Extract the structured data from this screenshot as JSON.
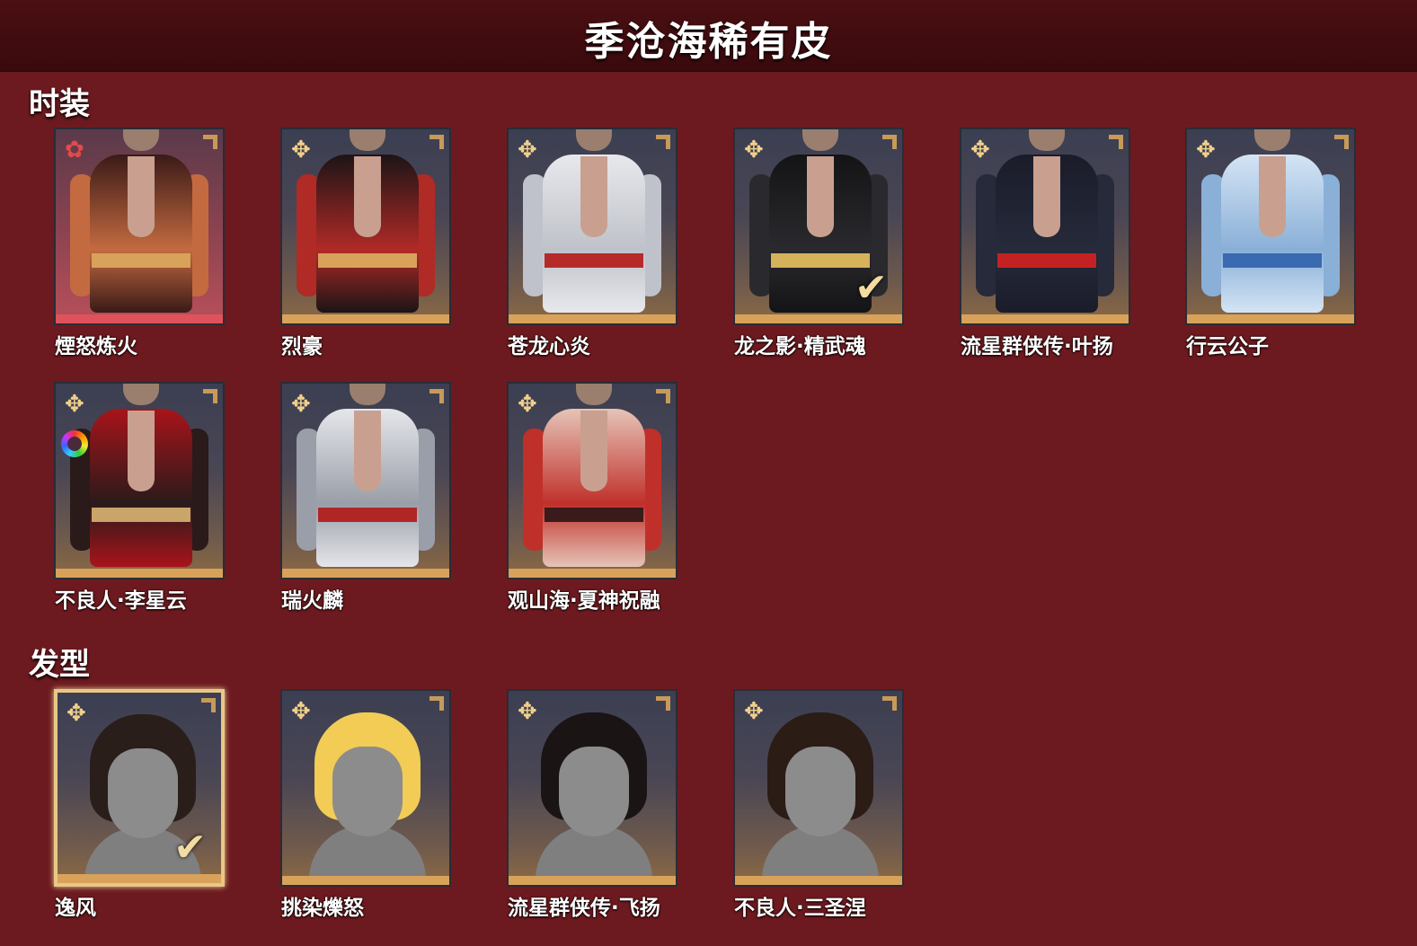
{
  "title": "季沧海稀有皮",
  "sections": {
    "outfits": {
      "title": "时装",
      "items": [
        {
          "name": "煙怒炼火",
          "rarity": "red",
          "rarity_icon": "red-star-icon",
          "colors": [
            "#3a1a18",
            "#c46a40",
            "#d9a25a"
          ]
        },
        {
          "name": "烈豪",
          "rarity": "gold",
          "rarity_icon": "gold-star-icon",
          "colors": [
            "#1c1416",
            "#b02a26",
            "#d9a25a"
          ]
        },
        {
          "name": "苍龙心炎",
          "rarity": "gold",
          "rarity_icon": "gold-star-icon",
          "colors": [
            "#e8e8ec",
            "#bfc2ca",
            "#b72a2a"
          ]
        },
        {
          "name": "龙之影·精武魂",
          "rarity": "gold",
          "rarity_icon": "gold-star-icon",
          "owned": true,
          "colors": [
            "#141416",
            "#2a2a2e",
            "#d6b25a"
          ]
        },
        {
          "name": "流星群侠传·叶扬",
          "rarity": "gold",
          "rarity_icon": "gold-star-icon",
          "colors": [
            "#1a1c2a",
            "#262a3a",
            "#c42222"
          ]
        },
        {
          "name": "行云公子",
          "rarity": "gold",
          "rarity_icon": "gold-star-icon",
          "colors": [
            "#d4e4f4",
            "#8ab0d8",
            "#3a6ab0"
          ]
        },
        {
          "name": "不良人·李星云",
          "rarity": "gold",
          "rarity_icon": "gold-star-icon",
          "dye": true,
          "colors": [
            "#a8141a",
            "#2a1a1a",
            "#c9a56a"
          ]
        },
        {
          "name": "瑞火麟",
          "rarity": "gold",
          "rarity_icon": "gold-star-icon",
          "colors": [
            "#e4e6ea",
            "#9a9ea8",
            "#b02626"
          ]
        },
        {
          "name": "观山海·夏神祝融",
          "rarity": "gold",
          "rarity_icon": "gold-star-icon",
          "colors": [
            "#e6c4b8",
            "#c0302a",
            "#3a1a1a"
          ]
        }
      ]
    },
    "hairstyles": {
      "title": "发型",
      "items": [
        {
          "name": "逸风",
          "rarity": "gold",
          "rarity_icon": "gold-star-icon",
          "owned": true,
          "selected": true,
          "hair_color": "#2a1e1a"
        },
        {
          "name": "挑染爍怒",
          "rarity": "gold",
          "rarity_icon": "gold-star-icon",
          "hair_color": "#f2cc55"
        },
        {
          "name": "流星群侠传·飞扬",
          "rarity": "gold",
          "rarity_icon": "gold-star-icon",
          "hair_color": "#1a1414"
        },
        {
          "name": "不良人·三圣涅",
          "rarity": "gold",
          "rarity_icon": "gold-star-icon",
          "hair_color": "#2c1c16"
        }
      ]
    }
  },
  "icons": {
    "gold-star-icon": "✥",
    "red-star-icon": "✿",
    "check-icon": "✔"
  }
}
